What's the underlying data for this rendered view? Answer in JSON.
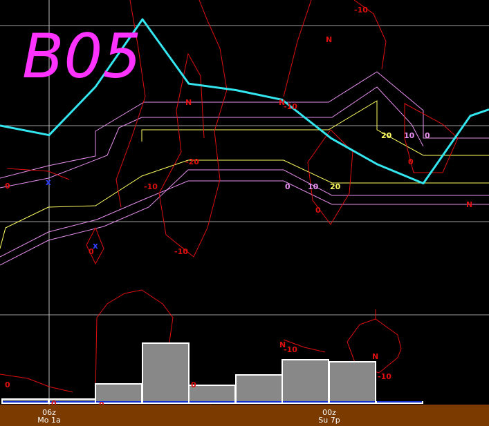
{
  "chart_data": {
    "type": "line",
    "title": "",
    "station_label": "B05",
    "colors": {
      "background": "#000000",
      "accent_line": "#33e6f0",
      "contour_red": "#e01010",
      "contour_pink": "#e890f0",
      "contour_yellow": "#ffff60",
      "bars": "#888888",
      "bar_outline": "#ffffff",
      "bar_baseline": "#1030d0",
      "axis_band": "#7a3a00",
      "station_label": "#ff33ff",
      "grid": "#a0a0a0"
    },
    "x_ticks": [
      {
        "label_top": "06z",
        "label_bottom": "Mo 1a"
      },
      {
        "label_top": "00z",
        "label_bottom": "Su 7p"
      }
    ],
    "contour_labels": [
      {
        "text": "-10",
        "color": "red"
      },
      {
        "text": "N",
        "color": "red"
      },
      {
        "text": "N",
        "color": "red"
      },
      {
        "text": "N",
        "color": "red"
      },
      {
        "text": "-10",
        "color": "red"
      },
      {
        "text": "20",
        "color": "yellow"
      },
      {
        "text": "10",
        "color": "pink"
      },
      {
        "text": "0",
        "color": "pink"
      },
      {
        "text": "0",
        "color": "red"
      },
      {
        "text": "-20",
        "color": "red"
      },
      {
        "text": "0",
        "color": "red"
      },
      {
        "text": "-10",
        "color": "red"
      },
      {
        "text": "0",
        "color": "pink"
      },
      {
        "text": "10",
        "color": "pink"
      },
      {
        "text": "20",
        "color": "yellow"
      },
      {
        "text": "0",
        "color": "red"
      },
      {
        "text": "N",
        "color": "red"
      },
      {
        "text": "0",
        "color": "red"
      },
      {
        "text": "-10",
        "color": "red"
      },
      {
        "text": "N",
        "color": "red"
      },
      {
        "text": "-10",
        "color": "red"
      },
      {
        "text": "N",
        "color": "red"
      },
      {
        "text": "-10",
        "color": "red"
      },
      {
        "text": "0",
        "color": "red"
      },
      {
        "text": "0",
        "color": "red"
      },
      {
        "text": "0",
        "color": "red"
      },
      {
        "text": "0",
        "color": "red"
      }
    ],
    "markers": [
      {
        "symbol": "x"
      },
      {
        "symbol": "x"
      }
    ],
    "bars": {
      "values": [
        0.06,
        0.07,
        0.3,
        0.95,
        0.28,
        0.45,
        0.68,
        0.65,
        0.0
      ]
    },
    "cyan_series": {
      "values": [
        0.64,
        0.61,
        0.76,
        0.97,
        0.77,
        0.75,
        0.72,
        0.6,
        0.52,
        0.46,
        0.67,
        0.69
      ]
    }
  }
}
